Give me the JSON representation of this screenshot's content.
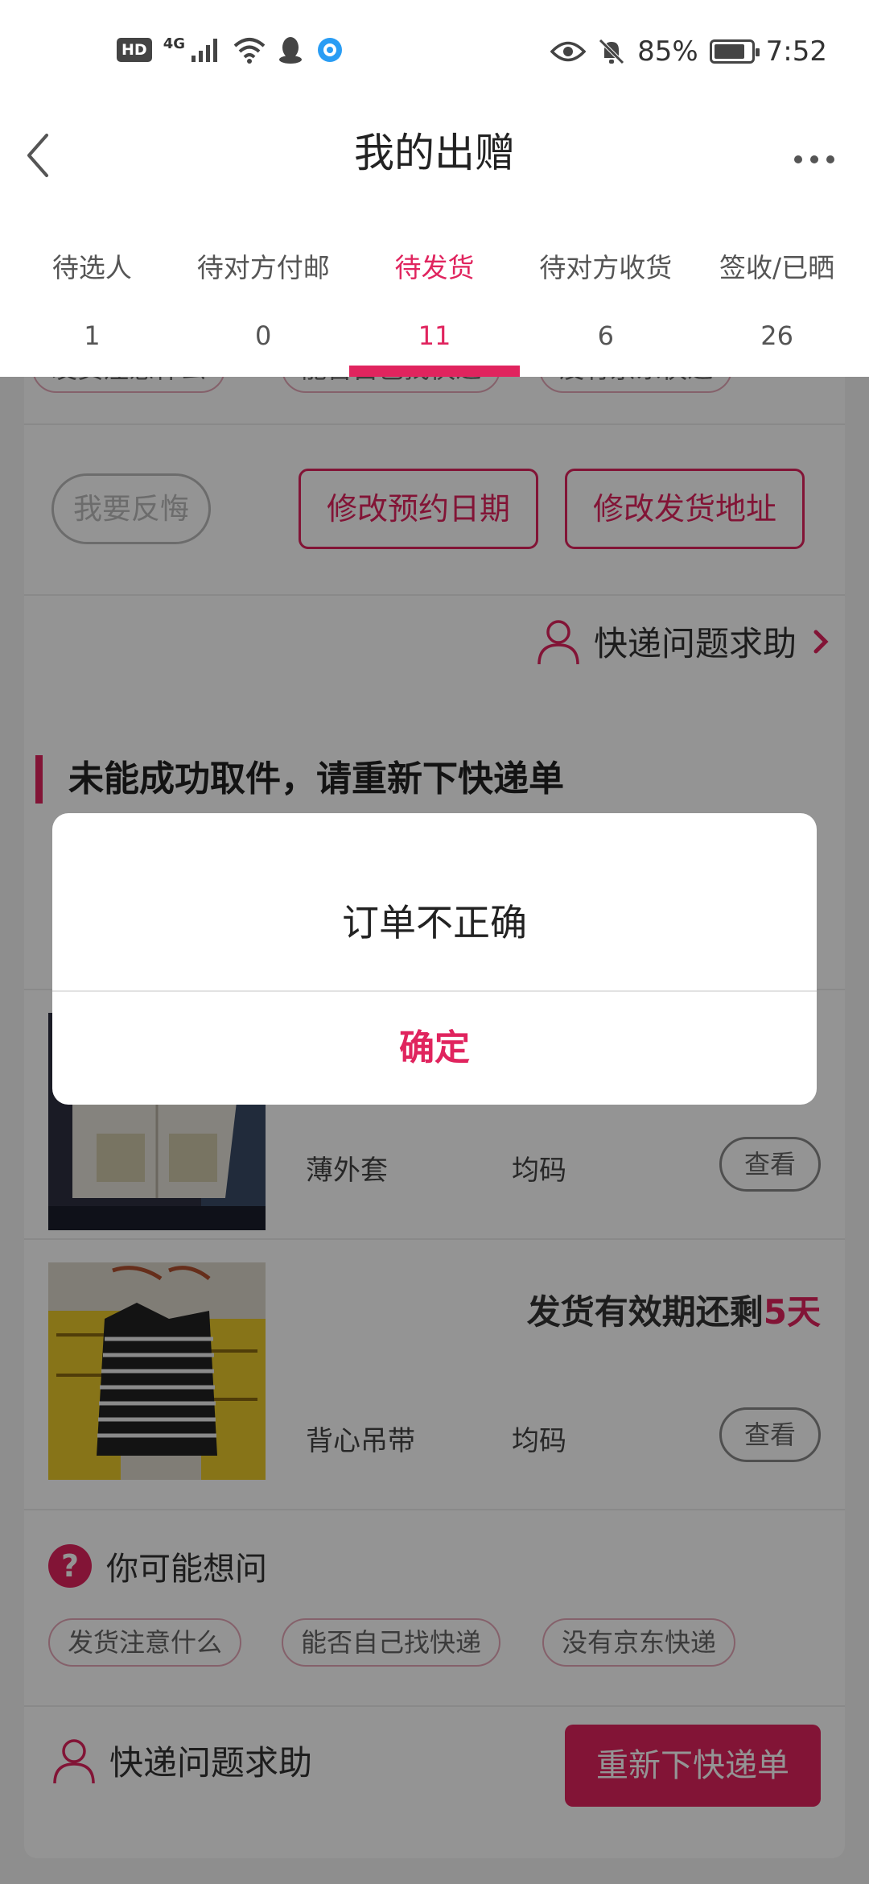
{
  "status_bar": {
    "network": "4G",
    "hd": "HD",
    "battery": "85%",
    "battery_level": 0.85,
    "time": "7:52",
    "icons": [
      "hd-icon",
      "signal-icon",
      "wifi-icon",
      "qq-icon",
      "browser-icon",
      "eye-icon",
      "mute-bell-icon",
      "battery-icon"
    ]
  },
  "nav": {
    "title": "我的出赠",
    "back_icon": "chevron-left-icon",
    "more_icon": "more-dots-icon"
  },
  "tabs": [
    {
      "label": "待选人",
      "count": "1"
    },
    {
      "label": "待对方付邮",
      "count": "0"
    },
    {
      "label": "待发货",
      "count": "11",
      "active": true
    },
    {
      "label": "待对方收货",
      "count": "6"
    },
    {
      "label": "签收/已晒",
      "count": "26"
    }
  ],
  "order_card": {
    "chips": [
      "发货注意什么",
      "能否自己找快递",
      "没有京东快递"
    ],
    "regret_button": "我要反悔",
    "change_date_button": "修改预约日期",
    "change_address_button": "修改发货地址",
    "help_label": "快递问题求助"
  },
  "section": {
    "title": "未能成功取件，请重新下快递单"
  },
  "items": [
    {
      "name": "薄外套",
      "size": "均码",
      "view_label": "查看"
    },
    {
      "name": "背心吊带",
      "size": "均码",
      "view_label": "查看",
      "deadline_prefix": "发货有效期还剩",
      "deadline_days": "5天"
    }
  ],
  "faq": {
    "title": "你可能想问",
    "chips": [
      "发货注意什么",
      "能否自己找快递",
      "没有京东快递"
    ]
  },
  "footer": {
    "help_label": "快递问题求助",
    "reorder_button": "重新下快递单"
  },
  "dialog": {
    "message": "订单不正确",
    "confirm": "确定"
  },
  "colors": {
    "accent": "#e0245e",
    "overlay": "rgba(0,0,0,0.42)"
  }
}
